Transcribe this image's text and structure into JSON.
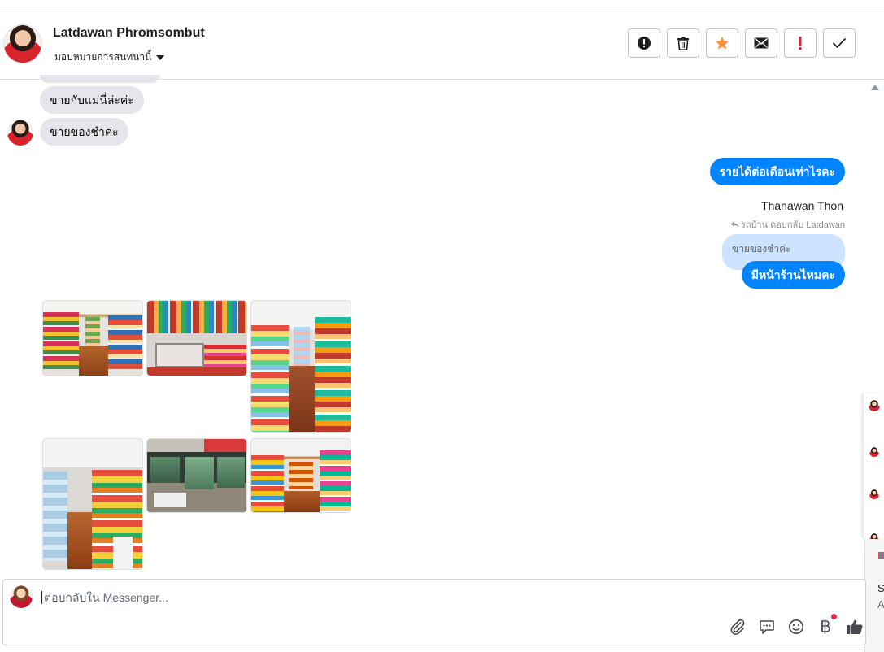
{
  "header": {
    "contact_name": "Latdawan Phromsombut",
    "assign_label": "มอบหมายการสนทนานี้",
    "actions": [
      {
        "name": "mark-spam-button",
        "icon": "exclamation-circle-icon"
      },
      {
        "name": "delete-button",
        "icon": "trash-icon"
      },
      {
        "name": "star-button",
        "icon": "star-icon"
      },
      {
        "name": "mark-unread-button",
        "icon": "envelope-icon"
      },
      {
        "name": "follow-up-button",
        "icon": "exclamation-icon"
      },
      {
        "name": "mark-done-button",
        "icon": "check-icon"
      }
    ]
  },
  "messages": {
    "incoming_1": "ขายกับแม่นี่ล่ะค่ะ",
    "incoming_2": "ขายของชำค่ะ",
    "outgoing_1": "รายได้ต่อเดือนเท่าไรคะ",
    "sender_name": "Thanawan Thon",
    "reply_note": "รถบ้าน ตอบกลับ Latdawan",
    "quoted_text": "ขายของชำค่ะ",
    "outgoing_2": "มีหน้าร้านไหมคะ"
  },
  "photos": [
    {
      "subject": "grocery-aisle"
    },
    {
      "subject": "checkout-counter"
    },
    {
      "subject": "long-aisle"
    },
    {
      "subject": "snack-aisle"
    },
    {
      "subject": "shop-front"
    },
    {
      "subject": "store-interior"
    }
  ],
  "composer": {
    "placeholder": "ตอบกลับใน Messenger...",
    "tools": [
      "paperclip-icon",
      "saved-reply-icon",
      "emoji-icon",
      "baht-icon",
      "thumbs-up-icon"
    ]
  },
  "side": {
    "letter_1": "S",
    "letter_2": "A"
  },
  "colors": {
    "accent": "#0084ff",
    "incoming_bubble": "#e4e6eb",
    "quoted_bubble": "#cce4ff",
    "star": "#f7923b",
    "alert_red": "#e41e3f"
  }
}
